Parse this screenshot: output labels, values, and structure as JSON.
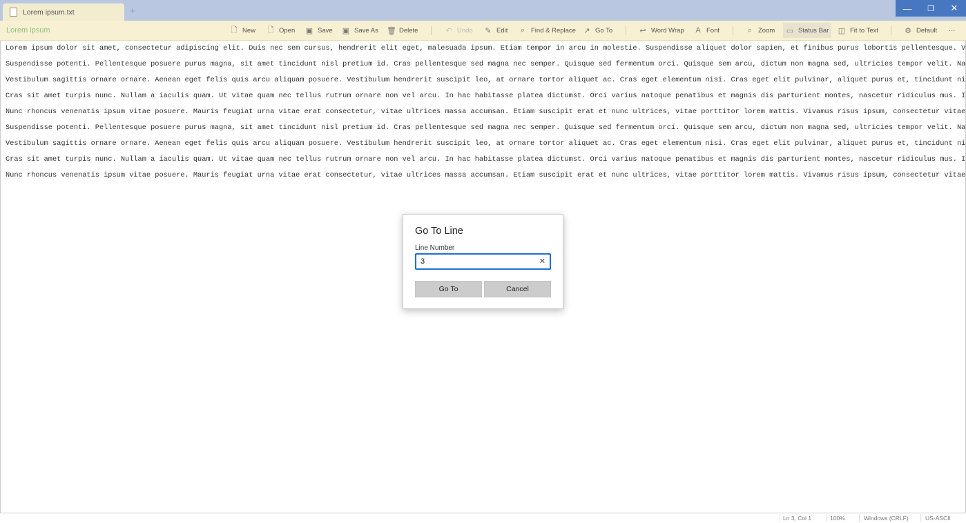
{
  "window": {
    "tab_title": "Lorem ipsum.txt",
    "new_tab": "+",
    "minimize": "—",
    "maximize": "❐",
    "close": "✕"
  },
  "toolbar": {
    "doc_title": "Lorem ipsum",
    "new": "New",
    "open": "Open",
    "save": "Save",
    "save_as": "Save As",
    "delete": "Delete",
    "undo": "Undo",
    "edit": "Edit",
    "find_replace": "Find & Replace",
    "go_to": "Go To",
    "word_wrap": "Word Wrap",
    "font": "Font",
    "zoom": "Zoom",
    "status_bar": "Status Bar",
    "fit_to_text": "Fit to Text",
    "default": "Default",
    "more": "···"
  },
  "editor": {
    "lines": [
      "Lorem ipsum dolor sit amet, consectetur adipiscing elit. Duis nec sem cursus, hendrerit elit eget, malesuada ipsum. Etiam tempor in arcu in molestie. Suspendisse aliquet dolor sapien, et finibus purus lobortis pellentesque. Vivamus sapien",
      "Suspendisse potenti. Pellentesque posuere purus magna, sit amet tincidunt nisl pretium id. Cras pellentesque sed magna nec semper. Quisque sed fermentum orci. Quisque sem arcu, dictum non magna sed, ultricies tempor velit. Nam eu pretium",
      "Vestibulum sagittis ornare ornare. Aenean eget felis quis arcu aliquam posuere. Vestibulum hendrerit suscipit leo, at ornare tortor aliquet ac. Cras eget elementum nisi. Cras eget elit pulvinar, aliquet purus et, tincidunt nisl. Aliquam e",
      "Cras sit amet turpis nunc. Nullam a iaculis quam. Ut vitae quam nec tellus rutrum ornare non vel arcu. In hac habitasse platea dictumst. Orci varius natoque penatibus et magnis dis parturient montes, nascetur ridiculus mus. In hac habitas",
      "Nunc rhoncus venenatis ipsum vitae posuere. Mauris feugiat urna vitae erat consectetur, vitae ultrices massa accumsan. Etiam suscipit erat et nunc ultrices, vitae porttitor lorem mattis. Vivamus risus ipsum, consectetur vitae placerat et,",
      "Suspendisse potenti. Pellentesque posuere purus magna, sit amet tincidunt nisl pretium id. Cras pellentesque sed magna nec semper. Quisque sed fermentum orci. Quisque sem arcu, dictum non magna sed, ultricies tempor velit. Nam eu pretium",
      "Vestibulum sagittis ornare ornare. Aenean eget felis quis arcu aliquam posuere. Vestibulum hendrerit suscipit leo, at ornare tortor aliquet ac. Cras eget elementum nisi. Cras eget elit pulvinar, aliquet purus et, tincidunt nisl. Aliquam e",
      "Cras sit amet turpis nunc. Nullam a iaculis quam. Ut vitae quam nec tellus rutrum ornare non vel arcu. In hac habitasse platea dictumst. Orci varius natoque penatibus et magnis dis parturient montes, nascetur ridiculus mus. In hac habitas",
      "Nunc rhoncus venenatis ipsum vitae posuere. Mauris feugiat urna vitae erat consectetur, vitae ultrices massa accumsan. Etiam suscipit erat et nunc ultrices, vitae porttitor lorem mattis. Vivamus risus ipsum, consectetur vitae placerat et,"
    ]
  },
  "dialog": {
    "title": "Go To Line",
    "label": "Line Number",
    "value": "3",
    "clear": "✕",
    "go_to": "Go To",
    "cancel": "Cancel"
  },
  "statusbar": {
    "position": "Ln 3, Col 1",
    "zoom": "100%",
    "line_ending": "Windows (CRLF)",
    "encoding": "US-ASCII"
  },
  "colors": {
    "titlebar": "#b9c8e0",
    "toolbar": "#f7f0d2",
    "accent": "#1f6ed4",
    "window_controls": "#4877c1",
    "doc_title": "#8fc47a"
  },
  "icons": {
    "tab": "document-icon",
    "new": "document-icon",
    "open": "open-document-icon",
    "save": "save-icon",
    "save_as": "save-as-icon",
    "delete": "trash-icon",
    "undo": "undo-icon",
    "edit": "pencil-icon",
    "find_replace": "search-icon",
    "go_to": "arrow-up-right-icon",
    "word_wrap": "wrap-icon",
    "font": "font-icon",
    "zoom": "magnifier-icon",
    "status_bar": "status-bar-icon",
    "fit_to_text": "fit-icon",
    "default": "gear-icon"
  }
}
